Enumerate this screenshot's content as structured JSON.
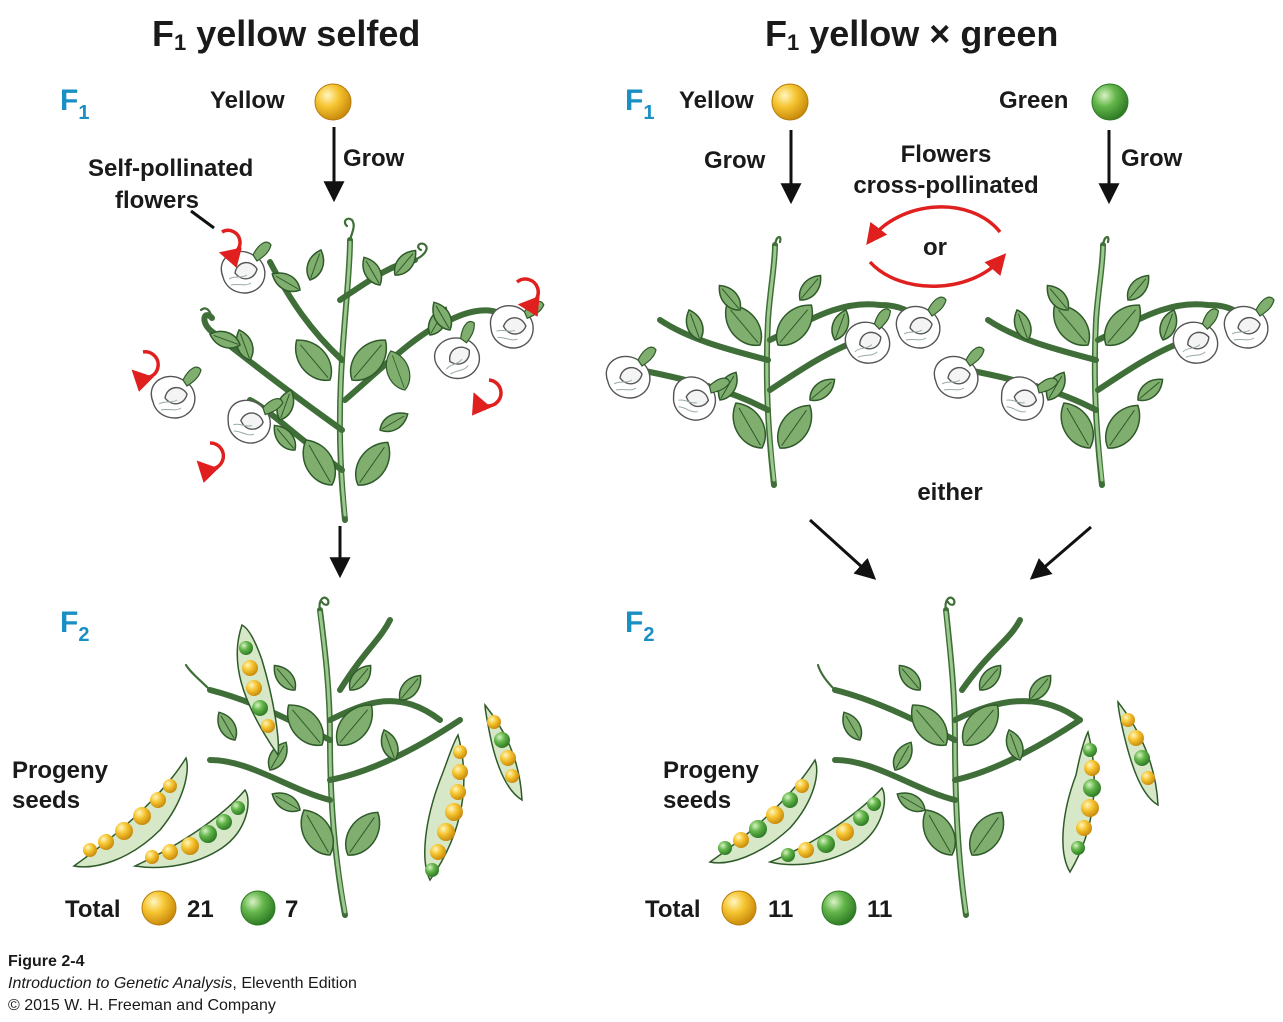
{
  "left_panel": {
    "title_pre": "F",
    "title_sub": "1",
    "title_post": " yellow selfed",
    "f1_main": "F",
    "f1_sub": "1",
    "yellow_label": "Yellow",
    "grow_label": "Grow",
    "self_pollinated_line1": "Self-pollinated",
    "self_pollinated_line2": "flowers",
    "f2_main": "F",
    "f2_sub": "2",
    "progeny_line1": "Progeny",
    "progeny_line2": "seeds",
    "total_label": "Total",
    "yellow_count": "21",
    "green_count": "7"
  },
  "right_panel": {
    "title_pre": "F",
    "title_sub": "1",
    "title_post": " yellow × green",
    "f1_main": "F",
    "f1_sub": "1",
    "yellow_label": "Yellow",
    "green_label": "Green",
    "grow_left": "Grow",
    "grow_right": "Grow",
    "flowers_line1": "Flowers",
    "flowers_line2": "cross-pollinated",
    "or_label": "or",
    "either_label": "either",
    "f2_main": "F",
    "f2_sub": "2",
    "progeny_line1": "Progeny",
    "progeny_line2": "seeds",
    "total_label": "Total",
    "yellow_count": "11",
    "green_count": "11"
  },
  "caption": {
    "figure": "Figure 2-4",
    "book_title": "Introduction to Genetic Analysis",
    "edition": ", Eleventh Edition",
    "copyright": "© 2015 W. H. Freeman and Company"
  },
  "colors": {
    "generation_label": "#1a8fc4",
    "pollination_arrow": "#e0201f",
    "yellow_seed": "#f2b21b",
    "green_seed": "#4fa63b",
    "leaf": "#7fae6e"
  }
}
